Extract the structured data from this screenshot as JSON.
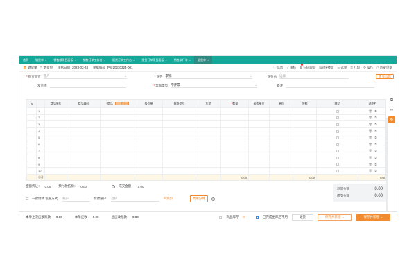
{
  "tabs": [
    {
      "label": "首页",
      "closable": false,
      "active": false
    },
    {
      "label": "销货单",
      "closable": true,
      "active": false
    },
    {
      "label": "销售额项目面板",
      "closable": true,
      "active": false
    },
    {
      "label": "销售订单工作台",
      "closable": true,
      "active": false
    },
    {
      "label": "报货订单工作台",
      "closable": true,
      "active": false
    },
    {
      "label": "报货订单项目面板",
      "closable": true,
      "active": false
    },
    {
      "label": "销售执行单",
      "closable": true,
      "active": false
    },
    {
      "label": "退货单",
      "closable": true,
      "active": true
    }
  ],
  "header": {
    "radio_return": "退货单",
    "radio_return2": "退货单",
    "date_label": "单据日期",
    "date_value": "2023-03-24",
    "no_label": "单据编号",
    "no_value": "PS-20230324-001",
    "tools": [
      {
        "label": "信息",
        "icon": "info-icon",
        "badge": false
      },
      {
        "label": "审核",
        "icon": "check-icon",
        "badge": false
      },
      {
        "label": "扫码跟踪",
        "icon": "scan-icon",
        "badge": true
      },
      {
        "label": "快捷键",
        "icon": "keyboard-icon",
        "badge": false
      },
      {
        "label": "选单",
        "icon": "list-icon",
        "badge": false
      },
      {
        "label": "打印",
        "icon": "print-icon",
        "badge": false
      },
      {
        "label": "操作",
        "icon": "gear-icon",
        "badge": false
      },
      {
        "label": "历史单据",
        "icon": "history-icon",
        "badge": false
      }
    ]
  },
  "form": {
    "customer_label": "购货单位",
    "customer_placeholder": "客户",
    "sales_label": "业务",
    "sales_value": "李锦",
    "salesman_label": "业务员",
    "salesman_placeholder": "选择",
    "more_label": "更多信息",
    "addr_label": "发货地",
    "type_label": "票据类型",
    "type_value": "不开票",
    "note_label": "备注"
  },
  "grid": {
    "columns": [
      "商品图片",
      "商品编码",
      "商品",
      "报价单",
      "规格型号",
      "车型",
      "数量",
      "采购单位",
      "单价",
      "金额",
      "赠品",
      "说明栏",
      "操作"
    ],
    "tag_label": "批量添加",
    "rows": [
      "1",
      "2",
      "3",
      "4",
      "5",
      "6",
      "7",
      "8",
      "9",
      "10"
    ],
    "total_label": "小计",
    "total_qty": "0.00",
    "total_amount": "0.00",
    "total_note": "0.00"
  },
  "summary": {
    "discount_label": "金额折让：",
    "discount_value": "0.00",
    "deduct_label": "预付款抵扣：",
    "deduct_value": "0.00",
    "deal_label": "成交金额：",
    "deal_value": "0.00",
    "checkbox_label": "一键付款 设置方式",
    "account_placeholder": "账户",
    "pay_label": "付款账户",
    "pay_placeholder": "选择",
    "add_label": "添加",
    "opt_btn": "费用分摊"
  },
  "amounts": {
    "return_label": "退货金额",
    "return_value": "0.00",
    "deal_label": "成交金额",
    "deal_value": "0.00"
  },
  "footer": {
    "a_label": "本单上次应收账款",
    "a_value": "0.00",
    "b_label": "本单应收",
    "b_value": "0.00",
    "c_label": "总应收账款",
    "c_value": "0.00",
    "stock_label": "商品库存",
    "stock_value": "0",
    "link_label": "已完成出库后不用",
    "btn_return": "退货",
    "btn_save_add": "保存并新增",
    "btn_save_print": "保存并新增"
  }
}
